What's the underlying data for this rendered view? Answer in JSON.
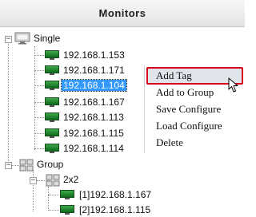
{
  "panel": {
    "title": "Monitors"
  },
  "tree": {
    "single": {
      "label": "Single",
      "expander": "−",
      "items": [
        {
          "label": "192.168.1.153"
        },
        {
          "label": "192.168.1.171"
        },
        {
          "label": "192.168.1.104",
          "selected": true
        },
        {
          "label": "192.168.1.167"
        },
        {
          "label": "192.168.1.113"
        },
        {
          "label": "192.168.1.115"
        },
        {
          "label": "192.168.1.114"
        }
      ]
    },
    "group": {
      "label": "Group",
      "expander": "−",
      "subgroup": {
        "label": "2x2",
        "expander": "−",
        "items": [
          {
            "label": "[1]192.168.1.167"
          },
          {
            "label": "[2]192.168.1.115"
          }
        ]
      }
    }
  },
  "context_menu": {
    "items": [
      {
        "label": "Add Tag",
        "highlighted": true
      },
      {
        "label": "Add to Group"
      },
      {
        "label": "Save Configure"
      },
      {
        "label": "Load Configure"
      },
      {
        "label": "Delete"
      }
    ]
  },
  "colors": {
    "menu_highlight_border": "#d9001b",
    "selection": "#3399ff",
    "monitor_icon": "#1f8a2e"
  }
}
